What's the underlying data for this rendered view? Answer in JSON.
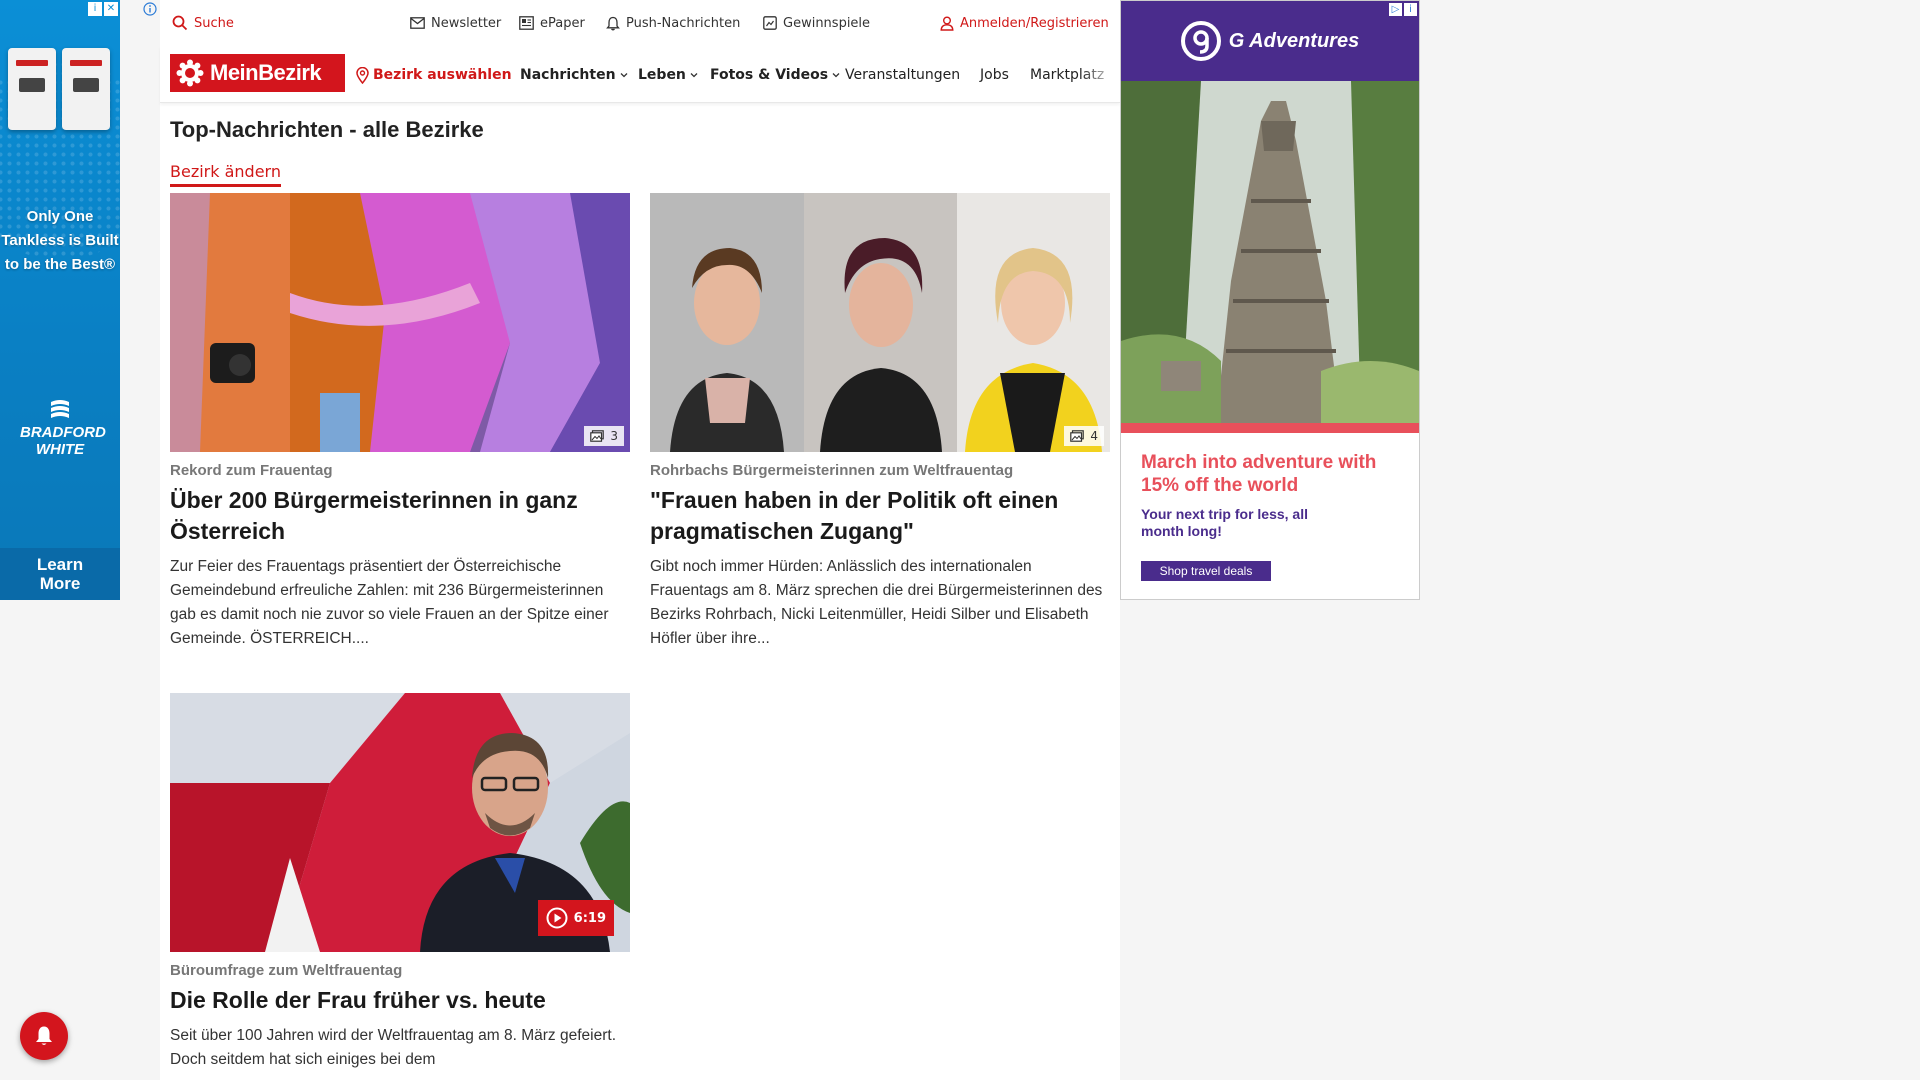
{
  "ad_left": {
    "slogan": "Only One Tankless is Built to be the Best®",
    "brand": "BRADFORD WHITE",
    "cta": "Learn More",
    "info_glyph": "i",
    "close_glyph": "✕"
  },
  "top_bar": {
    "search": "Suche",
    "newsletter": "Newsletter",
    "epaper": "ePaper",
    "push": "Push-Nachrichten",
    "contests": "Gewinnspiele",
    "login": "Anmelden/Registrieren"
  },
  "nav": {
    "logo": "MeinBezirk",
    "district": "Bezirk auswählen",
    "items": [
      {
        "label": "Nachrichten",
        "has_caret": true
      },
      {
        "label": "Leben",
        "has_caret": true
      },
      {
        "label": "Fotos & Videos",
        "has_caret": true
      },
      {
        "label": "Veranstaltungen",
        "has_caret": false
      },
      {
        "label": "Jobs",
        "has_caret": false
      },
      {
        "label": "Marktplatz",
        "has_caret": false
      }
    ]
  },
  "page": {
    "title": "Top-Nachrichten - alle Bezirke",
    "change_district": "Bezirk ändern"
  },
  "articles": [
    {
      "kicker": "Rekord zum Frauentag",
      "headline": "Über 200 Bürgermeisterinnen in ganz Österreich",
      "teaser": "Zur Feier des Frauentags präsentiert der Österreichische Gemeindebund erfreuliche Zahlen: mit 236 Bürgermeisterinnen gab es damit noch nie zuvor so viele Frauen an der Spitze einer Gemeinde. ÖSTERREICH....",
      "gallery_count": "3"
    },
    {
      "kicker": "Rohrbachs Bürgermeisterinnen zum Weltfrauentag",
      "headline": "\"Frauen haben in der Politik oft einen pragmatischen Zugang\"",
      "teaser": "Gibt noch immer Hürden: Anlässlich des internationalen Frauentags am 8. März sprechen die drei Bürgermeisterinnen des Bezirks Rohrbach, Nicki Leitenmüller, Heidi Silber und Elisabeth Höfler über ihre...",
      "gallery_count": "4"
    },
    {
      "kicker": "Büroumfrage zum Weltfrauentag",
      "headline": "Die Rolle der Frau früher vs. heute",
      "teaser": "Seit über 100 Jahren wird der Weltfrauentag am 8. März gefeiert. Doch seitdem hat sich einiges bei dem",
      "video_duration": "6:19"
    }
  ],
  "ad_right": {
    "brand": "G Adventures",
    "offer": "March into adventure with 15% off the world",
    "sub": "Your next trip for less, all month long!",
    "cta": "Shop travel deals"
  },
  "colors": {
    "brand_red": "#d3151d",
    "ad_purple": "#4a2c8c",
    "ad_coral": "#e8505b",
    "ad_blue": "#0b8fd6"
  },
  "icons": [
    "search-icon",
    "mail-icon",
    "newspaper-icon",
    "bell-icon",
    "gift-icon",
    "user-icon",
    "location-pin-icon",
    "chevron-down-icon",
    "gallery-icon",
    "play-icon",
    "info-icon"
  ]
}
